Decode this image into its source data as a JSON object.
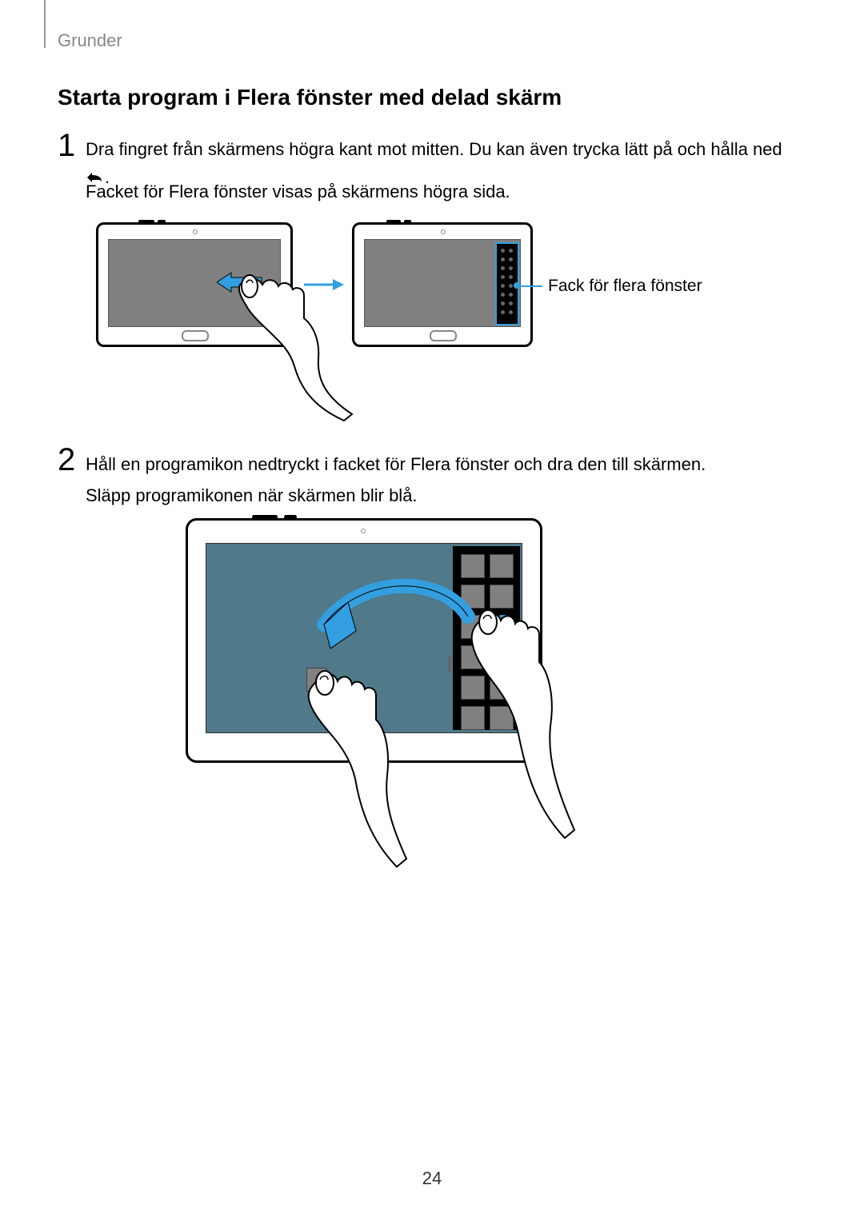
{
  "header": {
    "section": "Grunder"
  },
  "heading": "Starta program i Flera fönster med delad skärm",
  "step1": {
    "number": "1",
    "text_a": "Dra fingret från skärmens högra kant mot mitten. Du kan även trycka lätt på och hålla ned",
    "text_b": ".",
    "sub": "Facket för Flera fönster visas på skärmens högra sida."
  },
  "callout": "Fack för flera fönster",
  "step2": {
    "number": "2",
    "line1": "Håll en programikon nedtryckt i facket för Flera fönster och dra den till skärmen.",
    "line2": "Släpp programikonen när skärmen blir blå."
  },
  "page_number": "24"
}
